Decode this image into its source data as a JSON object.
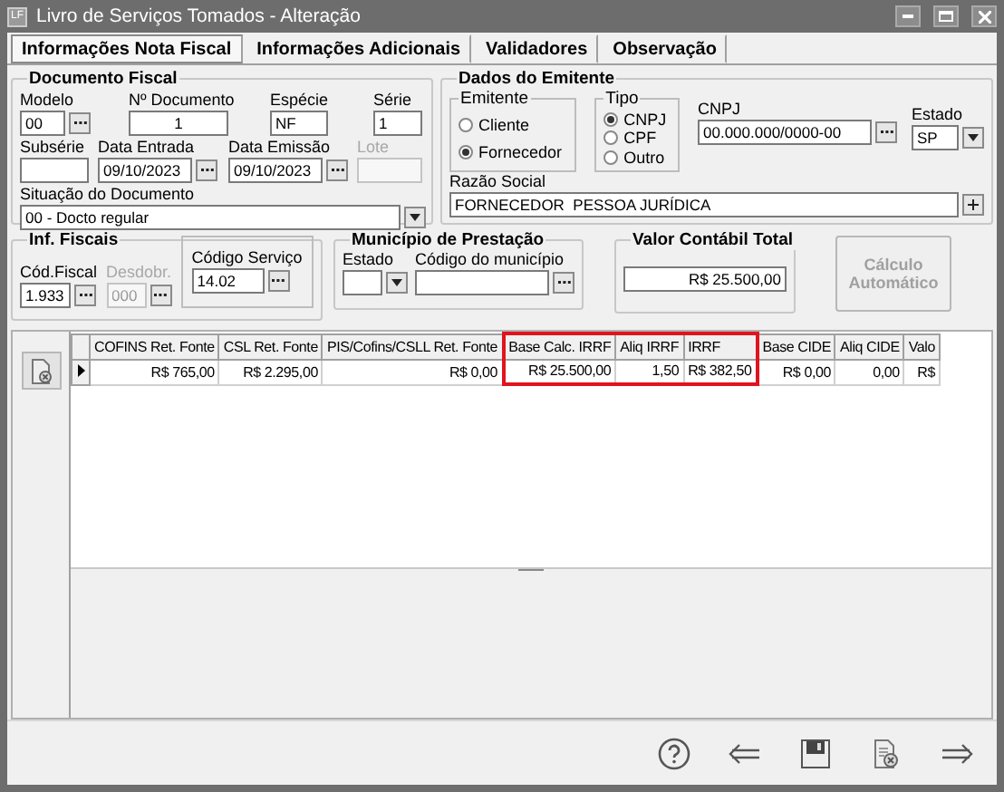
{
  "window": {
    "title": "Livro de Serviços Tomados - Alteração",
    "app_badge": "LF"
  },
  "tabs": [
    {
      "label": "Informações Nota Fiscal",
      "selected": true
    },
    {
      "label": "Informações Adicionais",
      "selected": false
    },
    {
      "label": "Validadores",
      "selected": false
    },
    {
      "label": "Observação",
      "selected": false
    }
  ],
  "documento_fiscal": {
    "title": "Documento Fiscal",
    "rows": [
      [
        {
          "label": "Modelo",
          "value": "00",
          "kind": "lookup",
          "disabled": false
        },
        {
          "label": "Nº Documento",
          "value": "1",
          "kind": "text",
          "disabled": false
        },
        {
          "label": "Espécie",
          "value": "NF",
          "kind": "text",
          "disabled": false
        },
        {
          "label": "Série",
          "value": "1",
          "kind": "text",
          "disabled": false
        }
      ],
      [
        {
          "label": "Subsérie",
          "kind": "text",
          "disabled": false
        },
        {
          "label": "Data Entrada",
          "value": "09/10/2023",
          "kind": "lookup",
          "disabled": false
        },
        {
          "label": "Data Emissão",
          "value": "09/10/2023",
          "kind": "lookup",
          "disabled": false
        },
        {
          "label": "Lote",
          "kind": "text",
          "disabled": true
        }
      ],
      [
        {
          "label": "Situação do Documento",
          "value": "00 - Docto regular",
          "kind": "select",
          "disabled": false
        }
      ]
    ]
  },
  "emitente": {
    "title": "Dados do Emitente",
    "emitente_group": {
      "title": "Emitente",
      "options": [
        {
          "label": "Cliente",
          "selected": false
        },
        {
          "label": "Fornecedor",
          "selected": true
        }
      ]
    },
    "tipo_group": {
      "title": "Tipo",
      "options": [
        {
          "label": "CNPJ",
          "selected": true
        },
        {
          "label": "CPF",
          "selected": false
        },
        {
          "label": "Outro",
          "selected": false
        }
      ]
    },
    "cnpj": {
      "label": "CNPJ",
      "value": "00.000.000/0000-00",
      "kind": "lookup",
      "disabled": false
    },
    "estado": {
      "label": "Estado",
      "value": "SP",
      "kind": "select",
      "disabled": false
    },
    "razao_social": {
      "label": "Razão Social",
      "value": "FORNECEDOR  PESSOA JURÍDICA",
      "kind": "plus",
      "disabled": false
    }
  },
  "inf_fiscais": {
    "title": "Inf. Fiscais",
    "fields": [
      {
        "label": "Cód.Fiscal",
        "value": "1.933",
        "kind": "lookup",
        "disabled": false
      },
      {
        "label": "Desdobr.",
        "value": "000",
        "kind": "lookup",
        "disabled": true
      }
    ],
    "servico": {
      "label": "Código Serviço",
      "value": "14.02",
      "kind": "lookup",
      "disabled": false
    }
  },
  "municipio": {
    "title": "Município de Prestação",
    "fields": [
      {
        "label": "Estado",
        "kind": "select",
        "disabled": false
      },
      {
        "label": "Código do município",
        "kind": "lookup",
        "disabled": false
      }
    ]
  },
  "valor_contabil": {
    "title": "Valor Contábil Total",
    "value": "R$ 25.500,00"
  },
  "calculo_button": {
    "label": "Cálculo Automático",
    "disabled": true
  },
  "table": {
    "columns": [
      {
        "label": "COFINS Ret. Fonte",
        "highlighted": false
      },
      {
        "label": "CSL Ret. Fonte",
        "highlighted": false
      },
      {
        "label": "PIS/Cofins/CSLL Ret. Fonte",
        "highlighted": false
      },
      {
        "label": "Base Calc. IRRF",
        "highlighted": true
      },
      {
        "label": "Aliq IRRF",
        "highlighted": true
      },
      {
        "label": "IRRF",
        "highlighted": true
      },
      {
        "label": "Base CIDE",
        "highlighted": false
      },
      {
        "label": "Aliq CIDE",
        "highlighted": false
      },
      {
        "label": "Valo",
        "highlighted": false
      }
    ],
    "rows": [
      {
        "current": true,
        "cells": [
          "R$ 765,00",
          "R$ 2.295,00",
          "R$ 0,00",
          "R$ 25.500,00",
          "1,50",
          "R$ 382,50",
          "R$ 0,00",
          "0,00",
          "R$"
        ]
      }
    ]
  }
}
